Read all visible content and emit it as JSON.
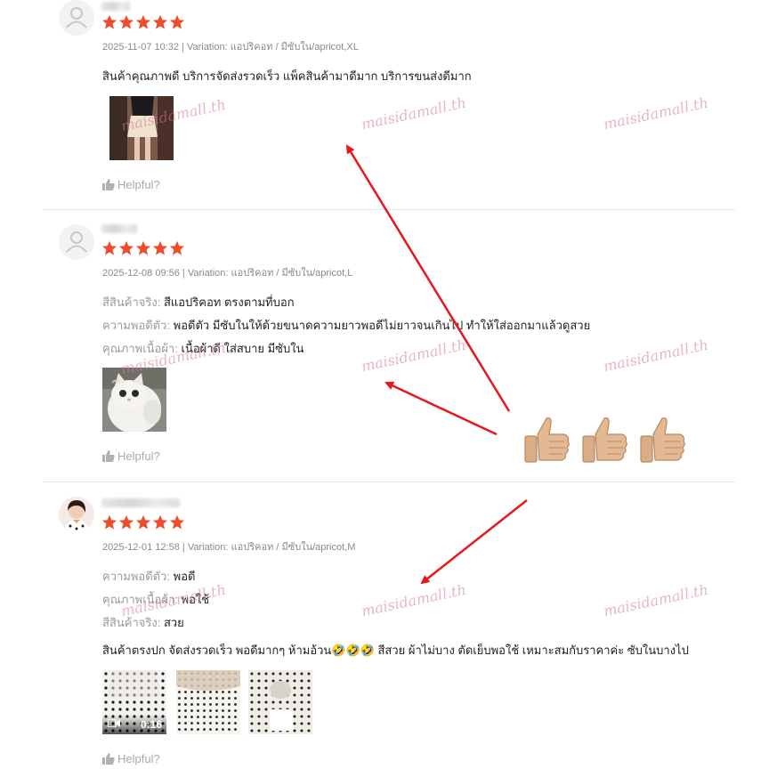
{
  "reviews": [
    {
      "stars": 5,
      "meta": "2025-11-07 10:32 | Variation: แอปริคอท / มีซับใน/apricot,XL",
      "text": "สินค้าคุณภาพดี บริการจัดส่งรวดเร็ว แพ็คสินค้ามาดีมาก บริการขนส่งดีมาก",
      "helpful": "Helpful?"
    },
    {
      "stars": 5,
      "meta": "2025-12-08 09:56 | Variation: แอปริคอท / มีซับใน/apricot,L",
      "attributes": [
        {
          "label": "สีสินค้าจริง:",
          "value": "สีแอปริคอท ตรงตามที่บอก"
        },
        {
          "label": "ความพอดีตัว:",
          "value": "พอดีตัว มีซับในให้ด้วยขนาดความยาวพอดีไม่ยาวจนเกินไป ทำให้ใส่ออกมาแล้วดูสวย"
        },
        {
          "label": "คุณภาพเนื้อผ้า:",
          "value": "เนื้อผ้าดี ใส่สบาย มีซับใน"
        }
      ],
      "helpful": "Helpful?"
    },
    {
      "stars": 5,
      "meta": "2025-12-01 12:58 | Variation: แอปริคอท / มีซับใน/apricot,M",
      "attributes": [
        {
          "label": "ความพอดีตัว:",
          "value": "พอดี"
        },
        {
          "label": "คุณภาพเนื้อผ้า:",
          "value": "พอใช้"
        },
        {
          "label": "สีสินค้าจริง:",
          "value": "สวย"
        }
      ],
      "text": "สินค้าตรงปก  จัดส่งรวดเร็ว  พอดีมากๆ ห้ามอ้วน🤣🤣🤣 สีสวย  ผ้าไม่บาง  ตัดเย็บพอใช้  เหมาะสมกับราคาค่ะ ซับในบางไป",
      "video_duration": "0:16",
      "helpful": "Helpful?"
    }
  ],
  "watermark": "maisidamall.th",
  "colors": {
    "star": "#ee4d2d",
    "arrow": "#e8161b",
    "text": "#222222",
    "meta": "#8a8a8a"
  }
}
